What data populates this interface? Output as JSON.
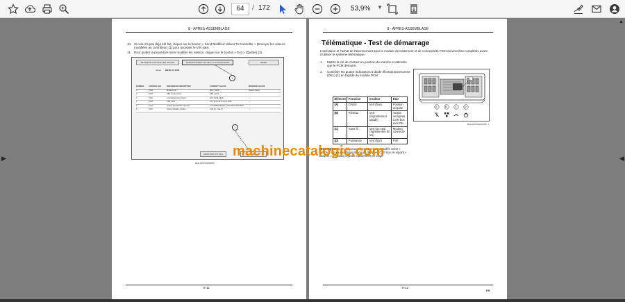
{
  "toolbar": {
    "icons": [
      "star-icon",
      "upload-icon",
      "print-icon",
      "zoom-search-icon",
      "arrow-up-circle-icon",
      "arrow-down-circle-icon",
      "cursor-icon",
      "hand-icon",
      "minus-circle-icon",
      "plus-circle-icon",
      "fit-page-icon",
      "scroll-mode-icon",
      "sign-icon",
      "mail-icon",
      "account-icon"
    ],
    "page_current": "64",
    "page_separator": "/",
    "page_total": "172",
    "zoom": "53,9%"
  },
  "left_page": {
    "header": "8 - APRES-ASSEMBLAGE",
    "step10_num": "10.",
    "step10_text": "Si cela n'a pas déjà été fait, cliquer sur le bouton « Send Modified Values To Controller » (Envoyer les valeurs modifiées au contrôleur) (1) pour accepter le VIN saisi.",
    "step11_num": "11.",
    "step11_text": "Pour quitter la procédure sans modifier les valeurs, cliquer sur le bouton « Exit » (Quitter) (2).",
    "screenshot": {
      "btn_retrieve": "RETRIEVE CONTROLLER VALUES",
      "btn_send": "SEND MODIFIED VALUES TO CONTROLLER",
      "btn_reset": "RESET",
      "serial_label": "Serial:",
      "serial_value": "BB4M 10 1000",
      "columns": [
        "NUMBER",
        "CONTROLLER",
        "PARAMETER DESCRIPTION",
        "CURRENT VALUES",
        "MODIFIED VALUES"
      ],
      "rows": [
        [
          "1",
          "PCM",
          "Model Code",
          "BKH 7 MI35",
          "[Select Code]"
        ],
        [
          "2",
          "PCM",
          "EBS Configuration",
          "EBS -20/1k",
          "---"
        ],
        [
          "3",
          "PCM",
          "Low Range Hood Option",
          "NOT AVAILABLE",
          "---"
        ],
        [
          "4",
          "PCM",
          "VKB Code",
          "STK DL1-FR-4L-F4-A-1981",
          "---"
        ],
        [
          "5",
          "PCM",
          "Vehicle Identification Number",
          "1CGXRD5WPX00T_ZXDCBDAJS30TBC0",
          "---"
        ],
        [
          "6",
          "PCM",
          "Kidney Radiator Fodder",
          "SHF 10 - [LE-TI]",
          "---"
        ]
      ],
      "btn_save": "SAVE DATA TO FILE",
      "btn_exit": "EXIT",
      "callout_1": "1",
      "callout_2": "2",
      "fig_ref": "RAIL19PKP0000000"
    },
    "footer_num": "8-11",
    "footer_lang": ""
  },
  "right_page": {
    "header": "8 - APRES-ASSEMBLAGE",
    "title": "Télématique - Test de démarrage",
    "intro": "L'activation et l'achat de l'abonnement pour le module de traitement et de connectivité PCM doivent être complétés avant d'utiliser le système télématique.",
    "step1_num": "1.",
    "step1_text": "Mettre la clé de contact en position de marche et attendre que le PCM démarre.",
    "step2_num": "2.",
    "step2_text": "Contrôler les quatre indicateurs à diode électroluminescente (DEL) (1) en façade du module PCM :",
    "table_headers": [
      "Élément",
      "Fonction",
      "Couleur",
      "État"
    ],
    "table_rows": [
      [
        "(A)",
        "GNSS",
        "Vert (fixe)",
        "Position acquise"
      ],
      [
        "(B)",
        "Réseau",
        "Vert (clignotement rapide)",
        "Toutes les lignes CAN bus sont OK"
      ],
      [
        "(C)",
        "Sans fil",
        "Vert (un seul clignotement 50 ms)",
        "Modem connecté"
      ],
      [
        "(D)",
        "Puissance",
        "Vert (fixe)",
        "Prêt"
      ]
    ],
    "remark_label": "REMARQUE:",
    "remark_text": "Si les faisceaux électriques sont installés selon « l'option 1 » sur un véhicule dépourvu de lignes CAN bus, le voyant « Network » (Réseau) clignote rapidement en rouge.",
    "figure": {
      "callout_1": "1",
      "led_labels": [
        "A",
        "B",
        "C",
        "D"
      ],
      "fig_code": "RAIL19PKP0000TEK",
      "fig_num": "1"
    },
    "footer_num": "8-12",
    "footer_lang": "FR"
  },
  "watermark": "machinecatalogic.com"
}
